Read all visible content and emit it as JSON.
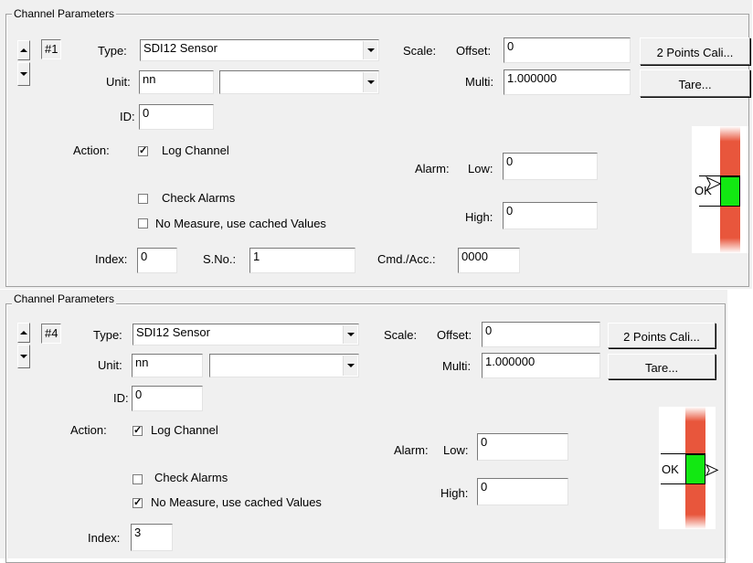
{
  "panels": [
    {
      "legend": "Channel Parameters",
      "channel_number": "#1",
      "type_label": "Type:",
      "type_value": "SDI12 Sensor",
      "unit_label": "Unit:",
      "unit_value": "nn",
      "unit_select": "",
      "id_label": "ID:",
      "id_value": "0",
      "action_label": "Action:",
      "log_channel_label": "Log Channel",
      "log_channel_checked": "✓",
      "check_alarms_label": "Check Alarms",
      "check_alarms_checked": "",
      "no_measure_label": "No Measure, use cached Values",
      "no_measure_checked": "",
      "index_label": "Index:",
      "index_value": "0",
      "sno_label": "S.No.:",
      "sno_value": "1",
      "cmd_label": "Cmd./Acc.:",
      "cmd_value": "0000",
      "scale_label": "Scale:",
      "offset_label": "Offset:",
      "offset_value": "0",
      "multi_label": "Multi:",
      "multi_value": "1.000000",
      "two_points_button": "2 Points Cali...",
      "tare_button": "Tare...",
      "alarm_label": "Alarm:",
      "low_label": "Low:",
      "low_value": "0",
      "high_label": "High:",
      "high_value": "0",
      "gauge_text": "OK"
    },
    {
      "legend": "Channel Parameters",
      "channel_number": "#4",
      "type_label": "Type:",
      "type_value": "SDI12 Sensor",
      "unit_label": "Unit:",
      "unit_value": "nn",
      "unit_select": "",
      "id_label": "ID:",
      "id_value": "0",
      "action_label": "Action:",
      "log_channel_label": "Log Channel",
      "log_channel_checked": "✓",
      "check_alarms_label": "Check Alarms",
      "check_alarms_checked": "",
      "no_measure_label": "No Measure, use cached Values",
      "no_measure_checked": "✓",
      "index_label": "Index:",
      "index_value": "3",
      "scale_label": "Scale:",
      "offset_label": "Offset:",
      "offset_value": "0",
      "multi_label": "Multi:",
      "multi_value": "1.000000",
      "two_points_button": "2 Points Cali...",
      "tare_button": "Tare...",
      "alarm_label": "Alarm:",
      "low_label": "Low:",
      "low_value": "0",
      "high_label": "High:",
      "high_value": "0",
      "gauge_text": "OK"
    }
  ],
  "colors": {
    "gauge_alarm": "#e8563c",
    "gauge_ok": "#12e812",
    "dialog_bg": "#f0f0f0"
  },
  "icons": [
    "spin-up-icon",
    "spin-down-icon",
    "dropdown-arrow-icon",
    "checkbox-icon",
    "mouse-cursor-icon"
  ]
}
